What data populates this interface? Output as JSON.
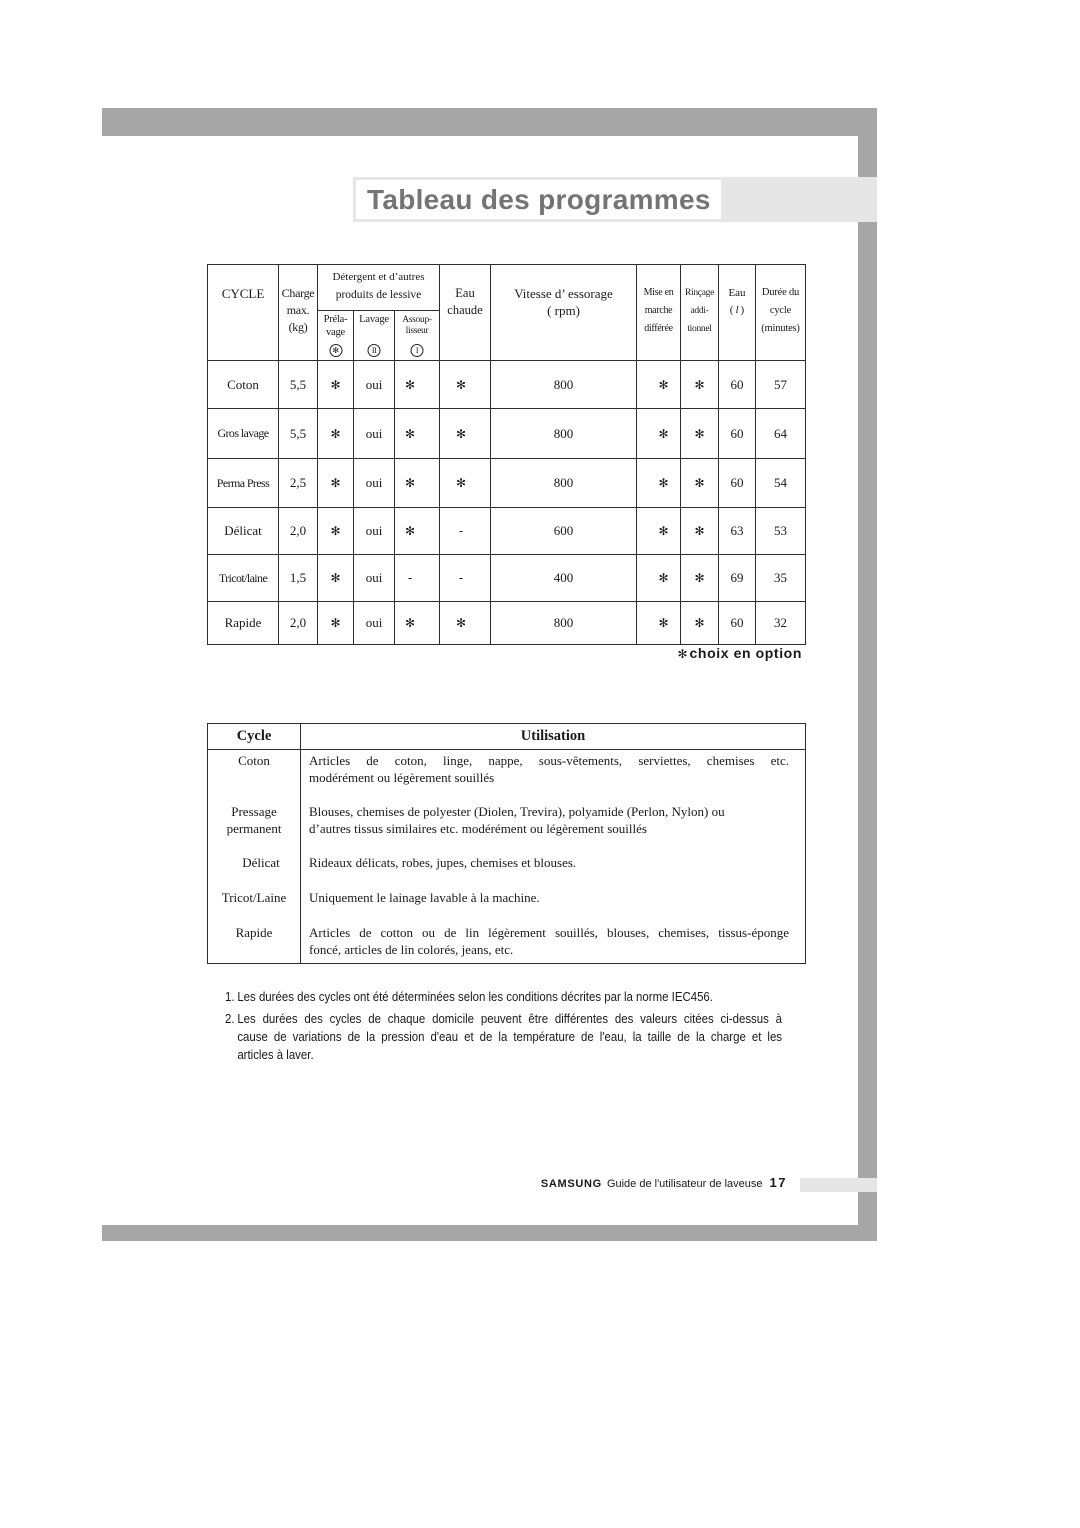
{
  "page": {
    "title": "Tableau des programmes"
  },
  "program_table": {
    "header": {
      "cycle": "CYCLE",
      "charge": [
        "Charge",
        "max.",
        "(kg)"
      ],
      "detergent": [
        "Détergent et d’autres",
        "produits de lessive"
      ],
      "prelavage": {
        "lines": [
          "Préla-",
          "vage"
        ],
        "icon": "prewash-compartment-icon",
        "symbol": "✻"
      },
      "lavage": {
        "lines": [
          "Lavage"
        ],
        "icon": "main-wash-compartment-icon",
        "symbol": "II"
      },
      "assouplisseur": {
        "lines": [
          "Assoup-",
          "lisseur"
        ],
        "icon": "softener-compartment-icon",
        "symbol": "I"
      },
      "eau_chaude": [
        "Eau",
        "chaude"
      ],
      "vitesse": [
        "Vitesse d’ essorage",
        "( rpm)"
      ],
      "mise_en_marche": [
        "Mise en",
        "marche",
        "différée"
      ],
      "rincage": [
        "Rinçage",
        "addi-",
        "tionnel"
      ],
      "eau": {
        "label": "Eau",
        "unit_open": "(",
        "unit": "l",
        "unit_close": ")"
      },
      "duree": [
        "Durée du",
        "cycle",
        "(minutes)"
      ]
    },
    "rows": [
      {
        "cycle": "Coton",
        "charge": "5,5",
        "prelavage": "✻",
        "lavage": "oui",
        "assouplisseur": "✻",
        "eau_chaude": "✻",
        "vitesse": "800",
        "mise_en_marche": "✻",
        "rincage": "✻",
        "eau": "60",
        "duree": "57"
      },
      {
        "cycle": "Gros lavage",
        "charge": "5,5",
        "prelavage": "✻",
        "lavage": "oui",
        "assouplisseur": "✻",
        "eau_chaude": "✻",
        "vitesse": "800",
        "mise_en_marche": "✻",
        "rincage": "✻",
        "eau": "60",
        "duree": "64"
      },
      {
        "cycle": "Perma Press",
        "charge": "2,5",
        "prelavage": "✻",
        "lavage": "oui",
        "assouplisseur": "✻",
        "eau_chaude": "✻",
        "vitesse": "800",
        "mise_en_marche": "✻",
        "rincage": "✻",
        "eau": "60",
        "duree": "54"
      },
      {
        "cycle": "Délicat",
        "charge": "2,0",
        "prelavage": "✻",
        "lavage": "oui",
        "assouplisseur": "✻",
        "eau_chaude": "-",
        "vitesse": "600",
        "mise_en_marche": "✻",
        "rincage": "✻",
        "eau": "63",
        "duree": "53"
      },
      {
        "cycle": "Tricot/laine",
        "charge": "1,5",
        "prelavage": "✻",
        "lavage": "oui",
        "assouplisseur": "-",
        "eau_chaude": "-",
        "vitesse": "400",
        "mise_en_marche": "✻",
        "rincage": "✻",
        "eau": "69",
        "duree": "35"
      },
      {
        "cycle": "Rapide",
        "charge": "2,0",
        "prelavage": "✻",
        "lavage": "oui",
        "assouplisseur": "✻",
        "eau_chaude": "✻",
        "vitesse": "800",
        "mise_en_marche": "✻",
        "rincage": "✻",
        "eau": "60",
        "duree": "32"
      }
    ]
  },
  "legend": {
    "mark": "✻",
    "label": "choix en option"
  },
  "usage_table": {
    "headers": {
      "cycle": "Cycle",
      "usage": "Utilisation"
    },
    "rows": [
      {
        "cycle": [
          "Coton"
        ],
        "usage": [
          "Articles de coton, linge, nappe, sous-vêtements, serviettes, chemises etc.",
          "modérément ou légèrement souillés"
        ]
      },
      {
        "cycle": [
          "Pressage",
          "permanent"
        ],
        "usage": [
          "Blouses, chemises de polyester (Diolen, Trevira), polyamide (Perlon, Nylon) ou",
          "d’autres tissus similaires etc. modérément ou légèrement souillés"
        ]
      },
      {
        "cycle": [
          "Délicat"
        ],
        "usage": [
          "Rideaux délicats, robes, jupes, chemises et blouses."
        ]
      },
      {
        "cycle": [
          "Tricot/Laine"
        ],
        "usage": [
          "Uniquement le lainage lavable à la machine."
        ]
      },
      {
        "cycle": [
          "Rapide"
        ],
        "usage": [
          "Articles de cotton ou de lin légèrement souillés, blouses, chemises, tissus-éponge",
          "foncé, articles de lin colorés, jeans, etc."
        ]
      }
    ]
  },
  "notes": [
    {
      "num": "1.",
      "lines": [
        "Les durées des cycles ont été déterminées selon les conditions décrites par la norme IEC456."
      ]
    },
    {
      "num": "2.",
      "lines": [
        "Les durées des cycles de chaque domicile peuvent être différentes des valeurs citées ci-dessus à",
        "cause de variations de la pression d'eau et de la température de l'eau, la taille de la charge et les",
        "articles à laver."
      ]
    }
  ],
  "footer": {
    "brand": "SAMSUNG",
    "guide": "Guide de l'utilisateur de laveuse",
    "page_number": "17"
  },
  "colors": {
    "frame": "#a6a6a6",
    "band": "#e6e6e6",
    "title_text": "#747474"
  }
}
